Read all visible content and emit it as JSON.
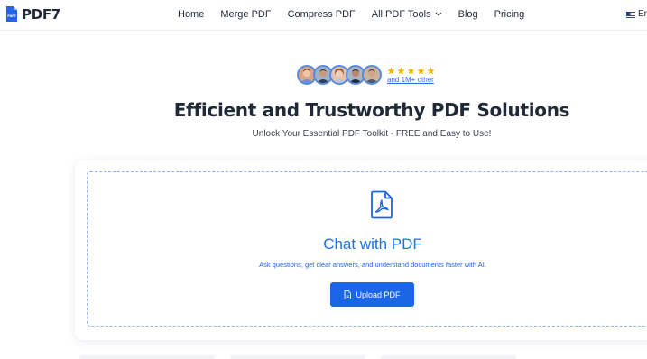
{
  "brand": {
    "name": "PDF7",
    "mark_text": "PDF7"
  },
  "nav": {
    "items": [
      "Home",
      "Merge PDF",
      "Compress PDF",
      "All PDF Tools",
      "Blog",
      "Pricing"
    ],
    "language": "Er"
  },
  "social_proof": {
    "rating_stars": 5,
    "users_text": "and 1M+ other"
  },
  "hero": {
    "title": "Efficient and Trustworthy PDF Solutions",
    "subtitle": "Unlock Your Essential PDF Toolkit - FREE and Easy to Use!"
  },
  "upload_card": {
    "title": "Chat with PDF",
    "description": "Ask questions, get clear answers, and understand documents faster with AI.",
    "button_label": "Upload PDF"
  },
  "colors": {
    "accent": "#1a66e6",
    "title_blue": "#1a73e8",
    "star": "#f5b400",
    "dashed_border": "#8fb4ee"
  }
}
